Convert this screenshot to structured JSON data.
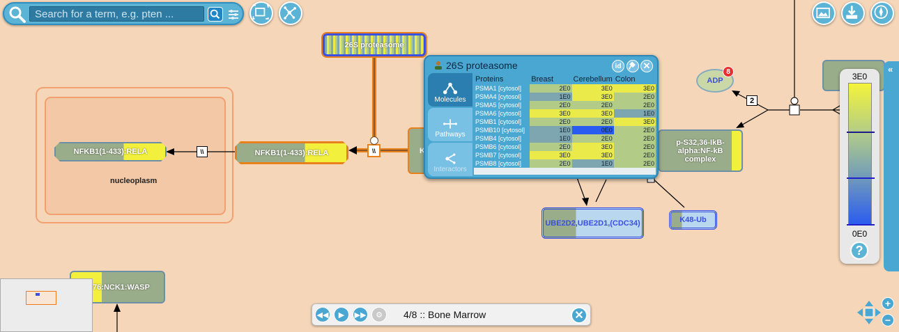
{
  "search": {
    "placeholder": "Search for a term, e.g. pten ..."
  },
  "nodes": {
    "proteasome_top": "26S proteasome",
    "nfkb_left": "NFKB1(1-433):RELA",
    "nfkb_mid": "NFKB1(1-433):RELA",
    "compartment": "nucleoplasm",
    "adp": "ADP",
    "adp_badge": "8",
    "pS32": "p-S32,36-IkB-alpha:NF-kB complex",
    "ube": "UBE2D2,UBE2D1,(CDC34)",
    "k48": "K48-Ub",
    "wasp": "P-76:NCK1:WASP",
    "edge_label_2": "2",
    "edge_label_bars": "\\\\"
  },
  "panel": {
    "title": "26S proteasome",
    "id_label": "id",
    "tabs": [
      "Molecules",
      "Pathways",
      "Interactors"
    ],
    "columns": [
      "Proteins",
      "Breast",
      "Cerebellum",
      "Colon"
    ],
    "rows": [
      {
        "name": "PSMA1 [cytosol]",
        "breast": "2E0",
        "cereb": "3E0",
        "colon": "3E0",
        "c1": "#b2cc88",
        "c2": "#eaea4a",
        "c3": "#eaea4a"
      },
      {
        "name": "PSMA4 [cytosol]",
        "breast": "1E0",
        "cereb": "3E0",
        "colon": "2E0",
        "c1": "#7ea6b0",
        "c2": "#eaea4a",
        "c3": "#b2cc88"
      },
      {
        "name": "PSMA5 [cytosol]",
        "breast": "2E0",
        "cereb": "2E0",
        "colon": "2E0",
        "c1": "#b2cc88",
        "c2": "#b2cc88",
        "c3": "#b2cc88"
      },
      {
        "name": "PSMA6 [cytosol]",
        "breast": "3E0",
        "cereb": "3E0",
        "colon": "1E0",
        "c1": "#eaea4a",
        "c2": "#eaea4a",
        "c3": "#7ea6b0"
      },
      {
        "name": "PSMB1 [cytosol]",
        "breast": "2E0",
        "cereb": "2E0",
        "colon": "3E0",
        "c1": "#b2cc88",
        "c2": "#b2cc88",
        "c3": "#eaea4a"
      },
      {
        "name": "PSMB10 [cytosol]",
        "breast": "1E0",
        "cereb": "0E0",
        "colon": "2E0",
        "c1": "#7ea6b0",
        "c2": "#2a5bf0",
        "c3": "#b2cc88"
      },
      {
        "name": "PSMB4 [cytosol]",
        "breast": "1E0",
        "cereb": "2E0",
        "colon": "2E0",
        "c1": "#7ea6b0",
        "c2": "#b2cc88",
        "c3": "#b2cc88"
      },
      {
        "name": "PSMB6 [cytosol]",
        "breast": "2E0",
        "cereb": "3E0",
        "colon": "2E0",
        "c1": "#b2cc88",
        "c2": "#eaea4a",
        "c3": "#b2cc88"
      },
      {
        "name": "PSMB7 [cytosol]",
        "breast": "3E0",
        "cereb": "3E0",
        "colon": "2E0",
        "c1": "#eaea4a",
        "c2": "#eaea4a",
        "c3": "#b2cc88"
      },
      {
        "name": "PSMB8 [cytosol]",
        "breast": "2E0",
        "cereb": "1E0",
        "colon": "2E0",
        "c1": "#b2cc88",
        "c2": "#7ea6b0",
        "c3": "#b2cc88"
      }
    ]
  },
  "legend": {
    "top": "3E0",
    "bottom": "0E0",
    "help": "?"
  },
  "player": {
    "info": "4/8 :: Bone Marrow"
  },
  "colors": {
    "accent": "#4aa7d2",
    "background": "#f5d6b8",
    "highlight_orange": "#f07b1a",
    "selection_blue": "#3b4fe0"
  }
}
